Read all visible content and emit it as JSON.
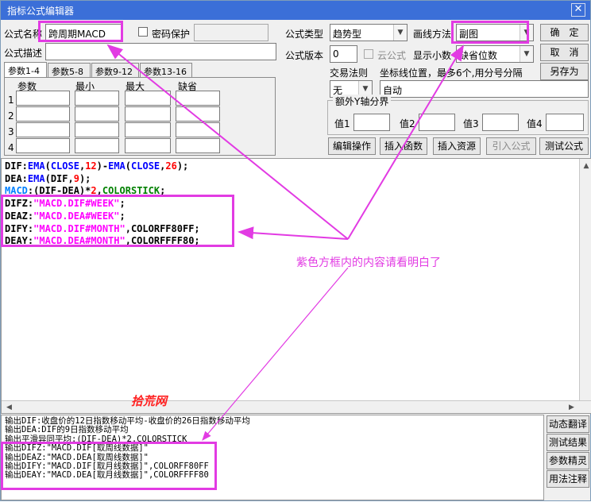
{
  "window": {
    "title": "指标公式编辑器",
    "close_glyph": "✕"
  },
  "form": {
    "name_label": "公式名称",
    "name_value": "跨周期MACD",
    "password_label": "密码保护",
    "password_value": "",
    "desc_label": "公式描述",
    "desc_value": "",
    "type_label": "公式类型",
    "type_value": "趋势型",
    "draw_label": "画线方法",
    "draw_value": "副图",
    "version_label": "公式版本",
    "version_value": "0",
    "cloud_label": "云公式",
    "decimals_label": "显示小数",
    "decimals_value": "缺省位数",
    "trade_label": "交易法则",
    "trade_value": "无",
    "coord_label": "坐标线位置，最多6个,用分号分隔",
    "coord_value": "自动",
    "yaxis_group_label": "额外Y轴分界",
    "y_labels": [
      "值1",
      "值2",
      "值3",
      "值4"
    ]
  },
  "buttons": {
    "ok": "确　定",
    "cancel": "取　消",
    "save_as": "另存为",
    "edit_op": "编辑操作",
    "insert_func": "插入函数",
    "insert_res": "插入资源",
    "import_formula": "引入公式",
    "test_formula": "测试公式",
    "dyn_translate": "动态翻译",
    "test_result": "测试结果",
    "param_tune": "参数精灵",
    "usage_notes": "用法注释"
  },
  "tabs": [
    "参数1-4",
    "参数5-8",
    "参数9-12",
    "参数13-16"
  ],
  "params": {
    "headers": [
      "参数",
      "最小",
      "最大",
      "缺省"
    ],
    "rows": [
      "1",
      "2",
      "3",
      "4"
    ]
  },
  "code_lines": [
    [
      {
        "t": "DIF:",
        "c": ""
      },
      {
        "t": "EMA",
        "c": "kw"
      },
      {
        "t": "(",
        "c": ""
      },
      {
        "t": "CLOSE",
        "c": "kw"
      },
      {
        "t": ",",
        "c": ""
      },
      {
        "t": "12",
        "c": "num"
      },
      {
        "t": ")-",
        "c": ""
      },
      {
        "t": "EMA",
        "c": "kw"
      },
      {
        "t": "(",
        "c": ""
      },
      {
        "t": "CLOSE",
        "c": "kw"
      },
      {
        "t": ",",
        "c": ""
      },
      {
        "t": "26",
        "c": "num"
      },
      {
        "t": ");",
        "c": ""
      }
    ],
    [
      {
        "t": "DEA:",
        "c": ""
      },
      {
        "t": "EMA",
        "c": "kw"
      },
      {
        "t": "(DIF,",
        "c": ""
      },
      {
        "t": "9",
        "c": "num"
      },
      {
        "t": ");",
        "c": ""
      }
    ],
    [
      {
        "t": "MACD",
        "c": "cyan"
      },
      {
        "t": ":(DIF-DEA)*",
        "c": ""
      },
      {
        "t": "2",
        "c": "num"
      },
      {
        "t": ",",
        "c": ""
      },
      {
        "t": "COLORSTICK",
        "c": "green"
      },
      {
        "t": ";",
        "c": ""
      }
    ],
    [
      {
        "t": "DIFZ:",
        "c": ""
      },
      {
        "t": "\"MACD.DIF#WEEK\"",
        "c": "str"
      },
      {
        "t": ";",
        "c": ""
      }
    ],
    [
      {
        "t": "DEAZ:",
        "c": ""
      },
      {
        "t": "\"MACD.DEA#WEEK\"",
        "c": "str"
      },
      {
        "t": ";",
        "c": ""
      }
    ],
    [
      {
        "t": "DIFY:",
        "c": ""
      },
      {
        "t": "\"MACD.DIF#MONTH\"",
        "c": "str"
      },
      {
        "t": ",COLORFF80FF;",
        "c": ""
      }
    ],
    [
      {
        "t": "DEAY:",
        "c": ""
      },
      {
        "t": "\"MACD.DEA#MONTH\"",
        "c": "str"
      },
      {
        "t": ",COLORFFFF80;",
        "c": ""
      }
    ]
  ],
  "output_lines": [
    "输出DIF:收盘价的12日指数移动平均-收盘价的26日指数移动平均",
    "输出DEA:DIF的9日指数移动平均",
    "输出平滑异同平均:(DIF-DEA)*2,COLORSTICK",
    "输出DIFZ:\"MACD.DIF[取周线数据]\"",
    "输出DEAZ:\"MACD.DEA[取周线数据]\"",
    "输出DIFY:\"MACD.DIF[取月线数据]\",COLORFF80FF",
    "输出DEAY:\"MACD.DEA[取月线数据]\",COLORFFFF80"
  ],
  "annotation": "紫色方框内的内容请看明白了",
  "watermark": "拾荒网",
  "colors": {
    "accent": "#e23be3",
    "titlebar": "#3b6fd8",
    "keyword": "#0000ff",
    "number": "#ff0000",
    "string": "#ff00ff"
  }
}
